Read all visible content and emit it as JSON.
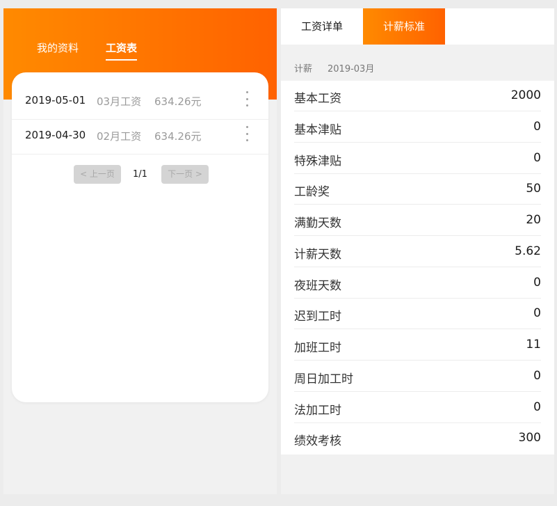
{
  "left": {
    "tabs": [
      "我的资料",
      "工资表"
    ],
    "records": [
      {
        "date": "2019-05-01",
        "month": "03月工资",
        "amount": "634.26元"
      },
      {
        "date": "2019-04-30",
        "month": "02月工资",
        "amount": "634.26元"
      }
    ],
    "pager": {
      "prev": "< 上一页",
      "count": "1/1",
      "next": "下一页 >"
    }
  },
  "right": {
    "tabs": [
      "工资详单",
      "计薪标准"
    ],
    "meta": {
      "label": "计薪",
      "period": "2019-03月"
    },
    "rows": [
      {
        "label": "基本工资",
        "value": "2000"
      },
      {
        "label": "基本津贴",
        "value": "0"
      },
      {
        "label": "特殊津贴",
        "value": "0"
      },
      {
        "label": "工龄奖",
        "value": "50"
      },
      {
        "label": "满勤天数",
        "value": "20"
      },
      {
        "label": "计薪天数",
        "value": "5.62"
      },
      {
        "label": "夜班天数",
        "value": "0"
      },
      {
        "label": "迟到工时",
        "value": "0"
      },
      {
        "label": "加班工时",
        "value": "11"
      },
      {
        "label": "周日加工时",
        "value": "0"
      },
      {
        "label": "法加工时",
        "value": "0"
      },
      {
        "label": "绩效考核",
        "value": "300"
      }
    ]
  },
  "colors": {
    "accent_start": "#ff8a00",
    "accent_end": "#ff6200"
  }
}
